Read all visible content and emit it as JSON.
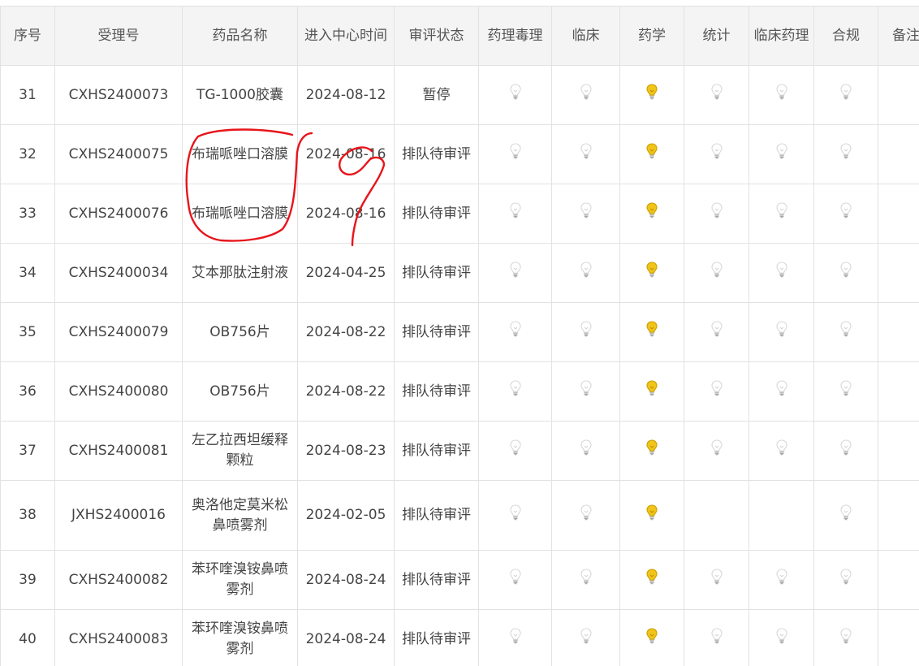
{
  "columns": [
    "序号",
    "受理号",
    "药品名称",
    "进入中心时间",
    "审评状态",
    "药理毒理",
    "临床",
    "药学",
    "统计",
    "临床药理",
    "合规",
    "备注"
  ],
  "rows": [
    {
      "no": "31",
      "id": "CXHS2400073",
      "name": "TG-1000胶囊",
      "date": "2024-08-12",
      "status": "暂停",
      "lights": [
        "off",
        "off",
        "on",
        "off",
        "off",
        "off"
      ]
    },
    {
      "no": "32",
      "id": "CXHS2400075",
      "name": "布瑞哌唑口溶膜",
      "date": "2024-08-16",
      "status": "排队待审评",
      "lights": [
        "off",
        "off",
        "on",
        "off",
        "off",
        "off"
      ]
    },
    {
      "no": "33",
      "id": "CXHS2400076",
      "name": "布瑞哌唑口溶膜",
      "date": "2024-08-16",
      "status": "排队待审评",
      "lights": [
        "off",
        "off",
        "on",
        "off",
        "off",
        "off"
      ]
    },
    {
      "no": "34",
      "id": "CXHS2400034",
      "name": "艾本那肽注射液",
      "date": "2024-04-25",
      "status": "排队待审评",
      "lights": [
        "off",
        "off",
        "on",
        "off",
        "off",
        "off"
      ]
    },
    {
      "no": "35",
      "id": "CXHS2400079",
      "name": "OB756片",
      "date": "2024-08-22",
      "status": "排队待审评",
      "lights": [
        "off",
        "off",
        "on",
        "off",
        "off",
        "off"
      ]
    },
    {
      "no": "36",
      "id": "CXHS2400080",
      "name": "OB756片",
      "date": "2024-08-22",
      "status": "排队待审评",
      "lights": [
        "off",
        "off",
        "on",
        "off",
        "off",
        "off"
      ]
    },
    {
      "no": "37",
      "id": "CXHS2400081",
      "name": "左乙拉西坦缓释颗粒",
      "date": "2024-08-23",
      "status": "排队待审评",
      "lights": [
        "off",
        "off",
        "on",
        "off",
        "off",
        "off"
      ]
    },
    {
      "no": "38",
      "id": "JXHS2400016",
      "name": "奥洛他定莫米松鼻喷雾剂",
      "date": "2024-02-05",
      "status": "排队待审评",
      "lights": [
        "off",
        "off",
        "on",
        "none",
        "none",
        "off"
      ]
    },
    {
      "no": "39",
      "id": "CXHS2400082",
      "name": "苯环喹溴铵鼻喷雾剂",
      "date": "2024-08-24",
      "status": "排队待审评",
      "lights": [
        "off",
        "off",
        "on",
        "off",
        "off",
        "off"
      ]
    },
    {
      "no": "40",
      "id": "CXHS2400083",
      "name": "苯环喹溴铵鼻喷雾剂",
      "date": "2024-08-24",
      "status": "排队待审评",
      "lights": [
        "off",
        "off",
        "on",
        "off",
        "off",
        "off"
      ]
    }
  ],
  "colors": {
    "bulb_on": "#f0c419",
    "bulb_off": "#d8d8d8",
    "annotation": "#e8141a"
  },
  "icons": {
    "on": "lightbulb-on-icon",
    "off": "lightbulb-off-icon"
  }
}
